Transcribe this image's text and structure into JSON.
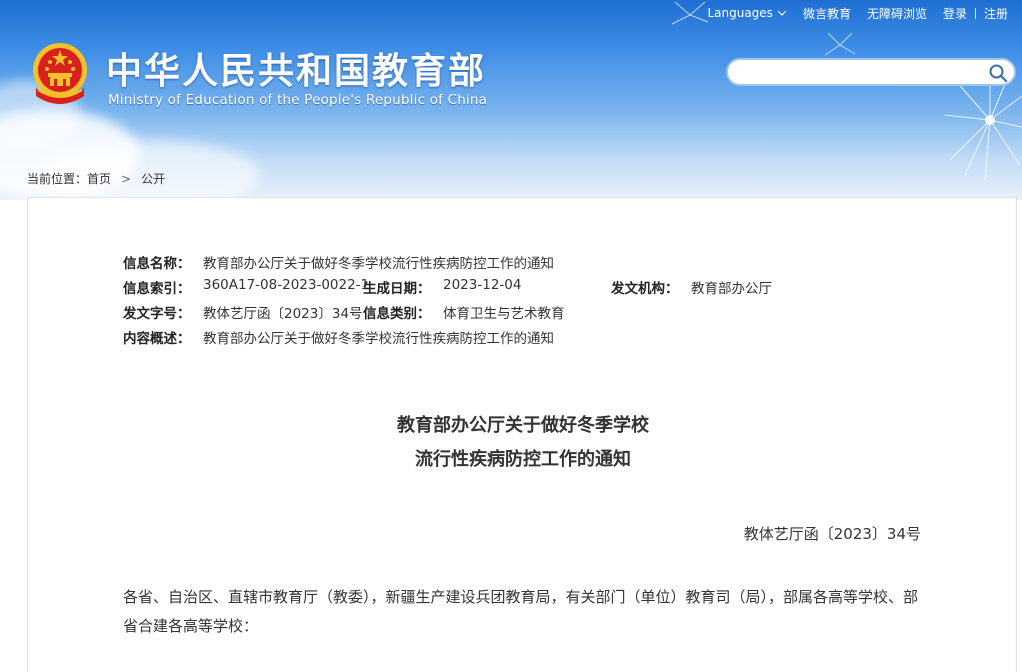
{
  "header": {
    "title_cn": "中华人民共和国教育部",
    "title_en": "Ministry of Education of the People's Republic of China",
    "emblem_icon": "national-emblem-icon",
    "top_nav": {
      "languages": "Languages",
      "weibo": "微言教育",
      "accessible": "无障碍浏览",
      "login": "登录",
      "register": "注册"
    },
    "search": {
      "placeholder": "",
      "value": "",
      "icon": "search-icon"
    }
  },
  "breadcrumb": {
    "prefix": "当前位置：",
    "home": "首页",
    "separator": ">",
    "current": "公开"
  },
  "meta": {
    "name_label": "信息名称：",
    "name_value": "教育部办公厅关于做好冬季学校流行性疾病防控工作的通知",
    "index_label": "信息索引：",
    "index_value": "360A17-08-2023-0022-1",
    "date_label": "生成日期：",
    "date_value": "2023-12-04",
    "org_label": "发文机构：",
    "org_value": "教育部办公厅",
    "docno_label": "发文字号：",
    "docno_value": "教体艺厅函〔2023〕34号",
    "category_label": "信息类别：",
    "category_value": "体育卫生与艺术教育",
    "summary_label": "内容概述：",
    "summary_value": "教育部办公厅关于做好冬季学校流行性疾病防控工作的通知"
  },
  "document": {
    "title_line1": "教育部办公厅关于做好冬季学校",
    "title_line2": "流行性疾病防控工作的通知",
    "number": "教体艺厅函〔2023〕34号",
    "body_paragraph": "各省、自治区、直辖市教育厅（教委），新疆生产建设兵团教育局，有关部门（单位）教育司（局），部属各高等学校、部省合建各高等学校："
  },
  "colors": {
    "banner_top": "#1f6fd3",
    "banner_bottom": "#e8f1fb",
    "emblem_red": "#d8201c",
    "emblem_gold": "#f5c12b"
  }
}
